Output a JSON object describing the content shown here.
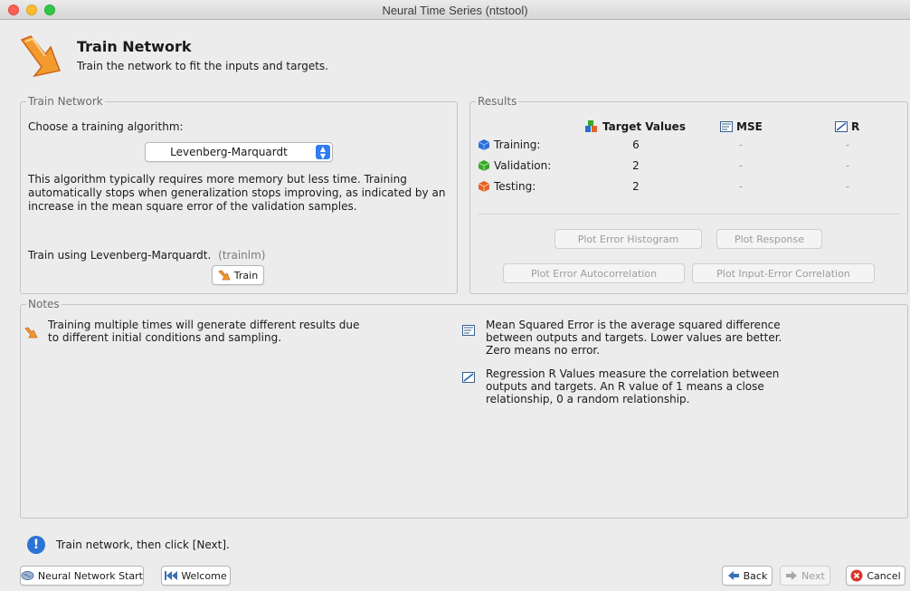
{
  "window": {
    "title": "Neural Time Series (ntstool)"
  },
  "header": {
    "title": "Train Network",
    "subtitle": "Train the network to fit the inputs and targets."
  },
  "train_panel": {
    "legend": "Train Network",
    "choose_label": "Choose a training algorithm:",
    "algorithm": "Levenberg-Marquardt",
    "description": "This algorithm typically requires more memory but less time. Training automatically stops when generalization stops improving, as indicated by an increase in the mean square error of the validation samples.",
    "train_using": "Train using Levenberg-Marquardt.",
    "train_fn": "(trainlm)",
    "train_button": "Train"
  },
  "results_panel": {
    "legend": "Results",
    "col_target": "Target Values",
    "col_mse": "MSE",
    "col_r": "R",
    "rows": [
      {
        "label": "Training:",
        "target": "6",
        "mse": "-",
        "r": "-"
      },
      {
        "label": "Validation:",
        "target": "2",
        "mse": "-",
        "r": "-"
      },
      {
        "label": "Testing:",
        "target": "2",
        "mse": "-",
        "r": "-"
      }
    ],
    "buttons": {
      "plot_error_histogram": "Plot Error Histogram",
      "plot_response": "Plot Response",
      "plot_error_autocorrelation": "Plot Error Autocorrelation",
      "plot_input_error_correlation": "Plot Input-Error Correlation"
    }
  },
  "notes_panel": {
    "legend": "Notes",
    "note_training": "Training multiple times will generate different results due to different initial conditions and sampling.",
    "note_mse": "Mean Squared Error is the average squared difference between outputs and targets. Lower values are better. Zero means no error.",
    "note_r": "Regression R Values measure the correlation between outputs and targets. An R value of 1 means a close relationship, 0 a random relationship."
  },
  "status": {
    "text": "Train network, then click [Next]."
  },
  "footer": {
    "nn_start": "Neural Network Start",
    "welcome": "Welcome",
    "back": "Back",
    "next": "Next",
    "cancel": "Cancel"
  },
  "colors": {
    "training_icon": "#2a6fd1",
    "validation_icon": "#3aa62a",
    "testing_icon": "#e0652a",
    "info_icon": "#2a74d6",
    "cancel_icon": "#d9362b"
  }
}
